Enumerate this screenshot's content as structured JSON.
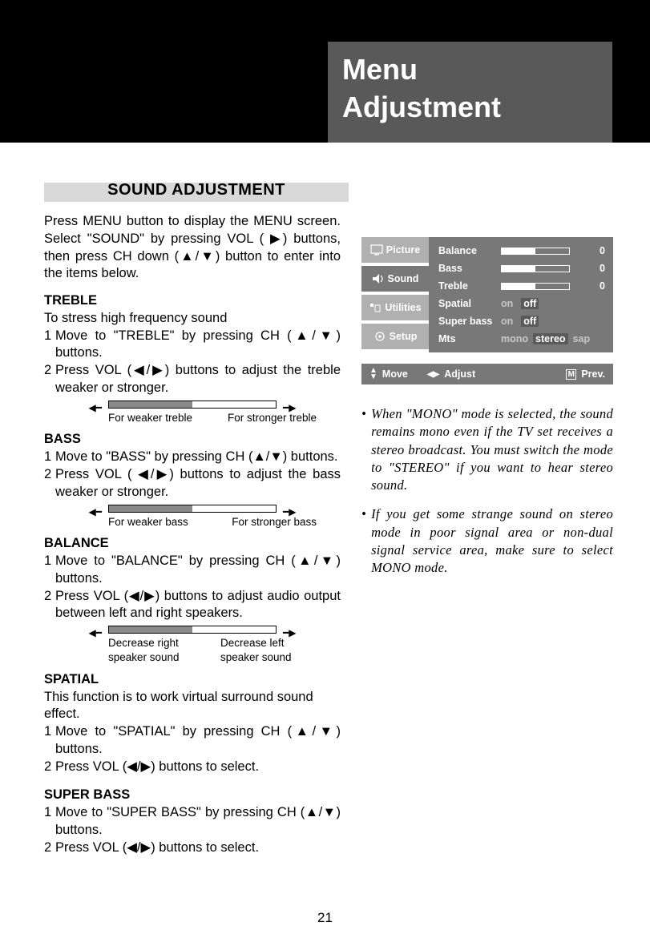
{
  "chapter": {
    "line1": "Menu",
    "line2": "Adjustment"
  },
  "section_title": "SOUND ADJUSTMENT",
  "intro": "Press MENU button to display the MENU screen. Select \"SOUND\" by pressing VOL ( ▶) buttons, then press CH down (▲/▼) button to enter into the items below.",
  "treble": {
    "title": "TREBLE",
    "lead": "To stress high frequency sound",
    "step1": "Move to \"TREBLE\" by pressing CH (▲/▼) buttons.",
    "step2": "Press VOL (◀/▶) buttons to adjust the treble weaker or stronger.",
    "left_label": "For weaker treble",
    "right_label": "For stronger treble"
  },
  "bass": {
    "title": "BASS",
    "step1": "Move to \"BASS\" by pressing CH (▲/▼) buttons.",
    "step2": "Press VOL ( ◀/▶) buttons to adjust the bass weaker or stronger.",
    "left_label": "For weaker bass",
    "right_label": "For stronger bass"
  },
  "balance": {
    "title": "BALANCE",
    "step1": "Move to \"BALANCE\" by pressing CH (▲/▼) buttons.",
    "step2": "Press VOL (◀/▶) buttons to adjust audio output between left and right speakers.",
    "left_label": "Decrease right speaker sound",
    "right_label": "Decrease left speaker sound"
  },
  "spatial": {
    "title": "SPATIAL",
    "lead": "This function is to work virtual surround sound effect.",
    "step1": "Move to \"SPATIAL\" by pressing CH (▲/▼) buttons.",
    "step2": "Press VOL (◀/▶) buttons to select."
  },
  "superbass": {
    "title": "SUPER BASS",
    "step1": "Move to \"SUPER BASS\" by pressing CH (▲/▼) buttons.",
    "step2": "Press VOL (◀/▶) buttons to select."
  },
  "osd": {
    "tabs": {
      "picture": "Picture",
      "sound": "Sound",
      "utilities": "Utilities",
      "setup": "Setup"
    },
    "rows": {
      "balance": {
        "name": "Balance",
        "value": "0"
      },
      "bass": {
        "name": "Bass",
        "value": "0"
      },
      "treble": {
        "name": "Treble",
        "value": "0"
      },
      "spatial": {
        "name": "Spatial",
        "on": "on",
        "off": "off"
      },
      "superbass": {
        "name": "Super bass",
        "on": "on",
        "off": "off"
      },
      "mts": {
        "name": "Mts",
        "mono": "mono",
        "stereo": "stereo",
        "sap": "sap"
      }
    }
  },
  "hints": {
    "move": "Move",
    "adjust": "Adjust",
    "prev": "Prev.",
    "m": "M"
  },
  "notes": {
    "n1": "When \"MONO\" mode is selected, the sound remains mono even if the TV set receives a stereo broadcast. You must switch the mode to \"STEREO\" if you want to hear stereo sound.",
    "n2": "If you get some strange sound on stereo mode in poor signal area or non-dual signal service area, make sure to select MONO mode."
  },
  "page": "21"
}
